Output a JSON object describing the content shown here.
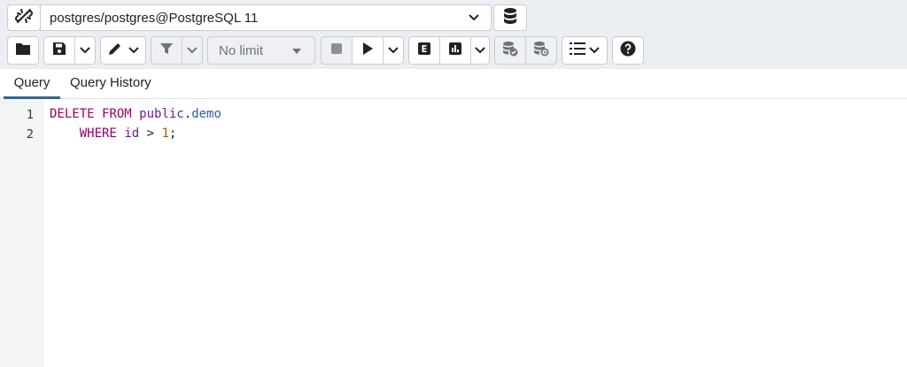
{
  "connection": {
    "label": "postgres/postgres@PostgreSQL 11"
  },
  "toolbar": {
    "limit_value": "No limit"
  },
  "tabs": [
    {
      "label": "Query"
    },
    {
      "label": "Query History"
    }
  ],
  "editor": {
    "line_numbers": [
      "1",
      "2"
    ],
    "line1": {
      "kw1": "DELETE",
      "kw2": "FROM",
      "schema": "public",
      "dot": ".",
      "table": "demo"
    },
    "line2": {
      "indent": "    ",
      "kw": "WHERE",
      "col": "id",
      "op": ">",
      "num": "1",
      "semi": ";"
    }
  },
  "icons": [
    "unlink-icon",
    "database-icon",
    "open-file-icon",
    "save-icon",
    "chevron-down-icon",
    "edit-pen-icon",
    "filter-icon",
    "stop-icon",
    "execute-icon",
    "explain-icon",
    "explain-analyze-icon",
    "commit-icon",
    "rollback-icon",
    "macros-list-icon",
    "help-icon"
  ],
  "colors": {
    "keyword": "#990066",
    "table": "#2962a8",
    "number": "#b45309",
    "tab_active": "#326690",
    "toolbar_bg": "#ebeef3"
  }
}
